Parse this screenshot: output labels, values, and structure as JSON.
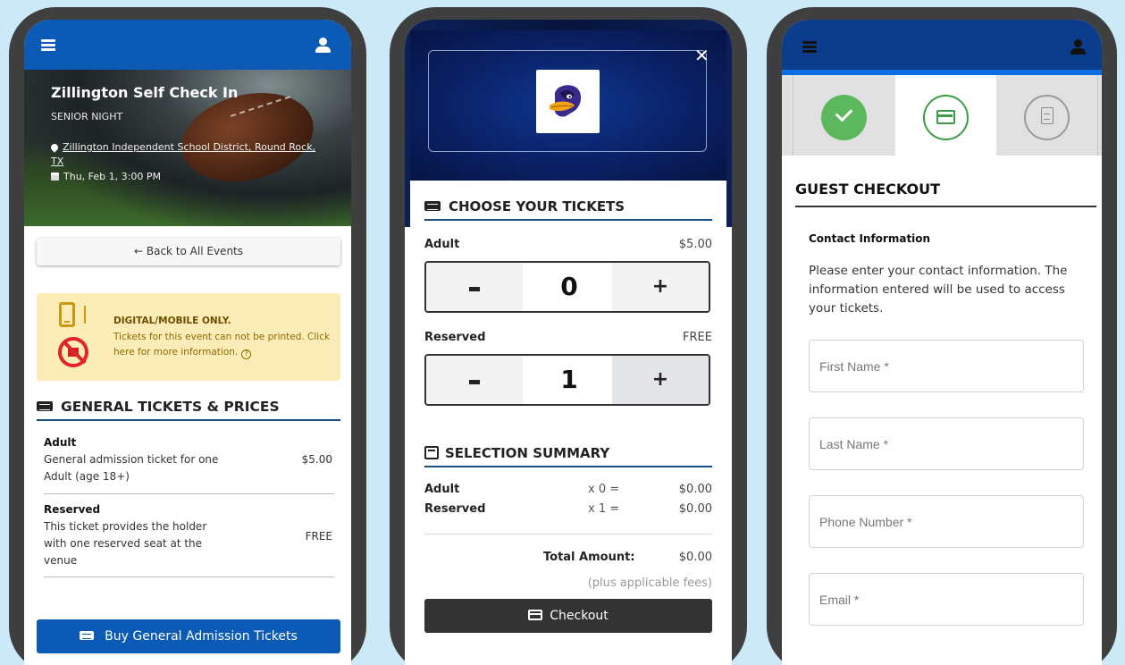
{
  "phone1": {
    "event_title": "Zillington Self Check In",
    "event_subtitle": "SENIOR NIGHT",
    "location": "Zillington Independent School District, Round Rock, TX",
    "date": "Thu, Feb 1, 3:00 PM",
    "back_label": "Back to All Events",
    "notice": {
      "heading": "DIGITAL/MOBILE ONLY.",
      "body": "Tickets for this event can not be printed. Click here for more information."
    },
    "section_title": "GENERAL TICKETS & PRICES",
    "tickets": [
      {
        "name": "Adult",
        "description": "General admission ticket for one Adult (age 18+)",
        "price": "$5.00"
      },
      {
        "name": "Reserved",
        "description": "This ticket provides the holder with one reserved seat at the venue",
        "price": "FREE"
      }
    ],
    "buy_label": "Buy General Admission Tickets"
  },
  "phone2": {
    "choose_title": "CHOOSE YOUR TICKETS",
    "tickets": [
      {
        "name": "Adult",
        "price": "$5.00",
        "quantity": "0",
        "minus": "-",
        "plus": "+"
      },
      {
        "name": "Reserved",
        "price": "FREE",
        "quantity": "1",
        "minus": "-",
        "plus": "+"
      }
    ],
    "summary_title": "SELECTION SUMMARY",
    "summary": [
      {
        "name": "Adult",
        "mult": "x 0 =",
        "amount": "$0.00"
      },
      {
        "name": "Reserved",
        "mult": "x 1 =",
        "amount": "$0.00"
      }
    ],
    "total_label": "Total Amount:",
    "total_amount": "$0.00",
    "fees_note": "(plus applicable fees)",
    "checkout_label": "Checkout"
  },
  "phone3": {
    "title": "GUEST CHECKOUT",
    "contact_title": "Contact Information",
    "contact_text": "Please enter your contact information. The information entered will be used to access your tickets.",
    "fields": {
      "first_name": "First Name *",
      "last_name": "Last Name *",
      "phone": "Phone Number *",
      "email": "Email *"
    }
  },
  "colors": {
    "primary_blue": "#0b5ab5",
    "notice_bg": "#fcedb8",
    "success_green": "#5cb85c",
    "page_bg": "#cce9f7"
  }
}
